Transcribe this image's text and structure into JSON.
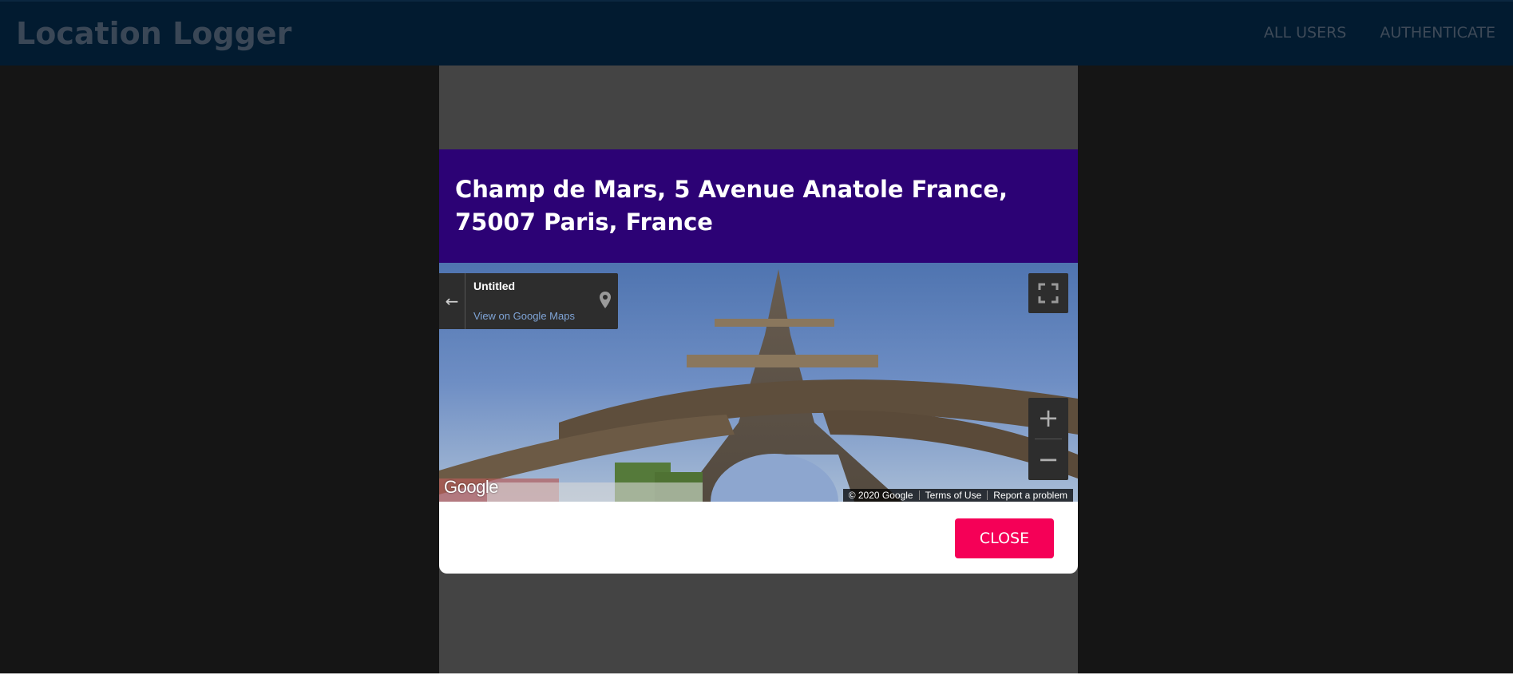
{
  "navbar": {
    "brand": "Location Logger",
    "links": [
      "ALL USERS",
      "AUTHENTICATE"
    ]
  },
  "modal": {
    "title": "Champ de Mars, 5 Avenue Anatole France, 75007 Paris, France",
    "streetview": {
      "place_name": "Untitled",
      "maps_link": "View on Google Maps",
      "logo": "Google",
      "attribution": [
        "© 2020 Google",
        "Terms of Use",
        "Report a problem"
      ],
      "zoom_in": "+",
      "zoom_out": "−",
      "icons": [
        "back-arrow-icon",
        "map-pin-icon",
        "fullscreen-icon"
      ]
    },
    "close_label": "CLOSE"
  },
  "colors": {
    "navbar": "#021b30",
    "modal_header": "#2c0275",
    "close_button": "#f50057",
    "backdrop": "#151515"
  }
}
